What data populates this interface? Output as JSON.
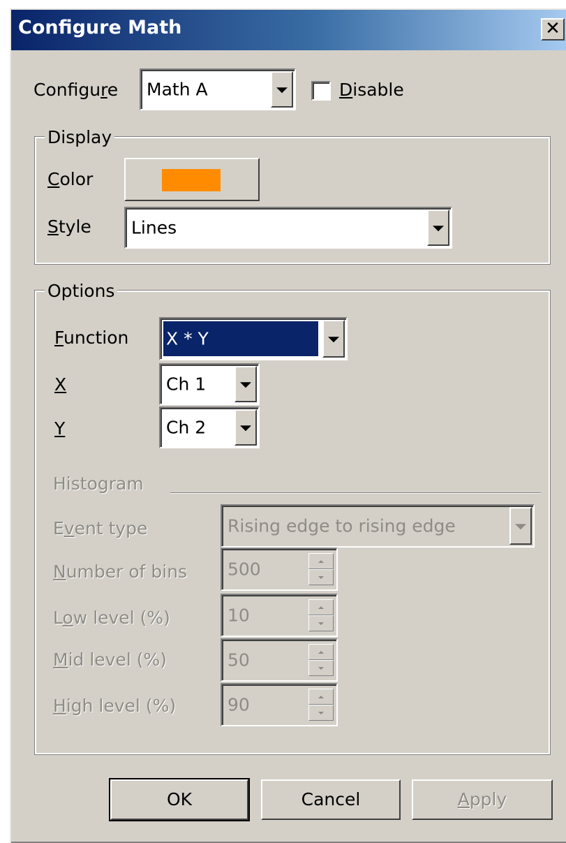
{
  "window": {
    "title": "Configure Math",
    "close_glyph": "✕"
  },
  "configure": {
    "label_pre": "Configu",
    "label_ul": "r",
    "label_post": "e",
    "value": "Math A",
    "disable_ul": "D",
    "disable_post": "isable",
    "disable_checked": false
  },
  "display": {
    "group_label": "Display",
    "color_ul": "C",
    "color_post": "olor",
    "color_value": "#ff8c00",
    "style_ul": "S",
    "style_post": "tyle",
    "style_value": "Lines"
  },
  "options": {
    "group_label": "Options",
    "function_ul": "F",
    "function_post": "unction",
    "function_value": "X * Y",
    "x_label": "X",
    "x_value": "Ch 1",
    "y_label": "Y",
    "y_value": "Ch 2"
  },
  "histogram": {
    "label": "Histogram",
    "event_pre": "E",
    "event_ul": "v",
    "event_post": "ent type",
    "event_value": "Rising edge to rising edge",
    "bins_ul": "N",
    "bins_post": "umber of bins",
    "bins_value": "500",
    "low_pre": "L",
    "low_ul": "o",
    "low_post": "w level (%)",
    "low_value": "10",
    "mid_ul": "M",
    "mid_post": "id level (%)",
    "mid_value": "50",
    "high_ul": "H",
    "high_post": "igh level (%)",
    "high_value": "90"
  },
  "buttons": {
    "ok": "OK",
    "cancel": "Cancel",
    "apply_ul": "A",
    "apply_post": "pply"
  }
}
